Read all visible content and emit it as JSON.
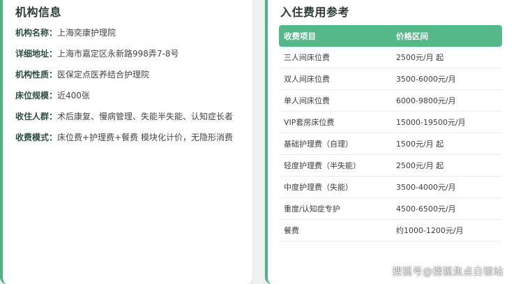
{
  "org": {
    "title": "机构信息",
    "fields": [
      {
        "label": "机构名称：",
        "value": "上海奕康护理院"
      },
      {
        "label": "详细地址：",
        "value": "上海市嘉定区永新路998弄7-8号"
      },
      {
        "label": "机构性质：",
        "value": "医保定点医养结合护理院"
      },
      {
        "label": "床位规模：",
        "value": "近400张"
      },
      {
        "label": "收住人群：",
        "value": "术后康复、慢病管理、失能半失能、认知症长者"
      },
      {
        "label": "收费模式：",
        "value": "床位费+护理费+餐费 模块化计价，无隐形消费"
      }
    ]
  },
  "fees": {
    "title": "入住费用参考",
    "header": {
      "item": "收费项目",
      "price": "价格区间"
    },
    "rows": [
      {
        "item": "三人间床位费",
        "price": "2500元/月 起"
      },
      {
        "item": "双人间床位费",
        "price": "3500-6000元/月"
      },
      {
        "item": "单人间床位费",
        "price": "6000-9800元/月"
      },
      {
        "item": "VIP套房床位费",
        "price": "15000-19500元/月"
      },
      {
        "item": "基础护理费（自理）",
        "price": "1500元/月 起"
      },
      {
        "item": "轻度护理费（半失能）",
        "price": "2500元/月 起"
      },
      {
        "item": "中度护理费（失能）",
        "price": "3500-4000元/月"
      },
      {
        "item": "重度/认知症专护",
        "price": "4500-6500元/月"
      },
      {
        "item": "餐费",
        "price": "约1000-1200元/月"
      }
    ]
  },
  "watermark": "搜狐号@搜狐焦点白银站"
}
